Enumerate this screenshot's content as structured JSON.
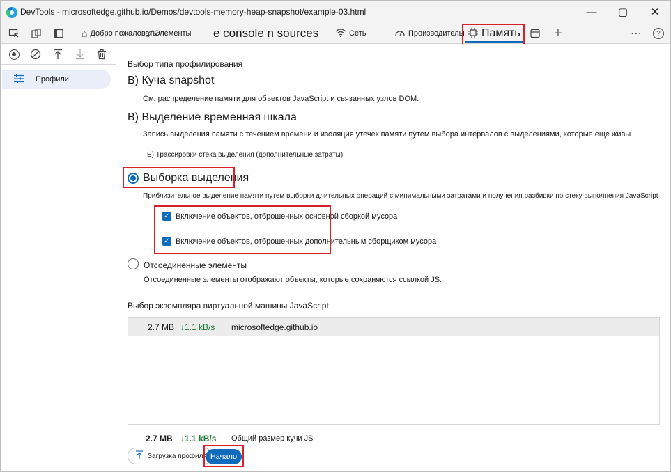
{
  "window": {
    "title": "DevTools - microsoftedge.github.io/Demos/devtools-memory-heap-snapshot/example-03.html",
    "minimize": "—",
    "maximize": "▢",
    "close": "✕"
  },
  "toolbar": {
    "tabs": {
      "welcome": "Добро пожаловать",
      "elements": "Элементы",
      "console_sources": "e console n sources",
      "network": "Сеть",
      "performance": "Производительность",
      "memory": "Память"
    },
    "add_tab": "+",
    "more": "⋯",
    "help": "?"
  },
  "left_panel": {
    "profiles_label": "Профили"
  },
  "main": {
    "select_profiling_type": "Выбор типа профилирования",
    "heap_snapshot": {
      "title": "В) Куча snapshot",
      "desc": "См. распределение памяти для объектов JavaScript и связанных узлов DOM."
    },
    "allocation_timeline": {
      "title": "В) Выделение временная шкала",
      "desc": "Запись выделения памяти с течением времени и изоляция утечек памяти путем выбора интервалов с выделениями, которые еще живы",
      "stack_traces": "Е)   Трассировки стека выделения (дополнительные затраты)"
    },
    "allocation_sampling": {
      "title": "Выборка выделения",
      "desc": "Приблизительное выделение памяти путем выборки длительных операций с минимальными затратами и получения разбивки по стеку выполнения JavaScript",
      "checkbox_major_gc": "Включение объектов, отброшенных основной сборкой мусора",
      "checkbox_minor_gc": "Включение объектов, отброшенных дополнительным сборщиком мусора"
    },
    "detached_elements": {
      "title": "Отсоединенные элементы",
      "desc": "Отсоединенные элементы отображают объекты, которые сохраняются ссылкой JS."
    },
    "vm_selection_title": "Выбор экземпляра виртуальной машины JavaScript",
    "vm_row": {
      "size": "2.7 MB",
      "rate": "↓1.1 kB/s",
      "origin": "microsoftedge.github.io"
    },
    "total": {
      "size": "2.7 MB",
      "rate": "↓1.1 kB/s",
      "label": "Общий размер кучи JS"
    },
    "load_profile_button": "Загрузка профиля",
    "start_button": "Начало"
  },
  "colors": {
    "accent": "#0f6cbd",
    "highlight_box": "#d6202a",
    "rate_green": "#1e7b34"
  }
}
